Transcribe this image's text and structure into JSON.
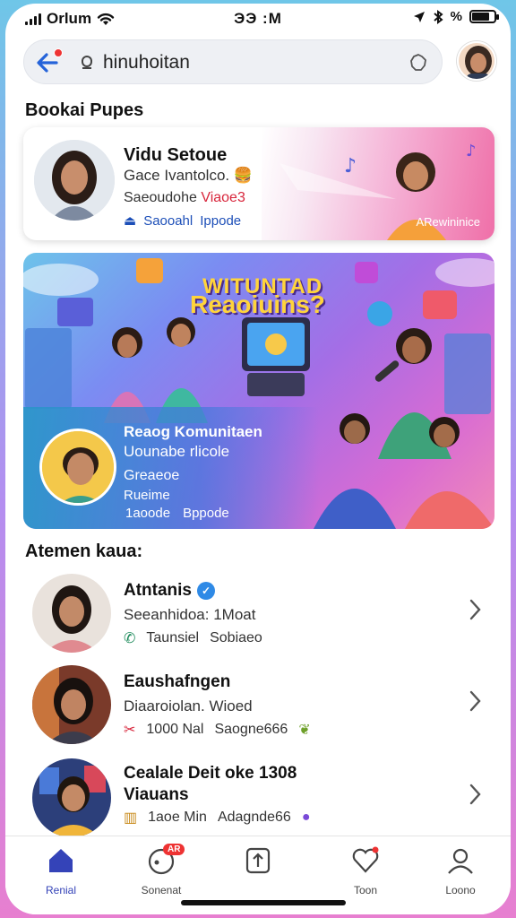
{
  "status_bar": {
    "carrier": "Orlum",
    "time": "ЭЭ :M",
    "extra": "%"
  },
  "search": {
    "query": "hinuhoitan"
  },
  "sections": {
    "top_title": "Bookai Pupes",
    "list_title": "Atemen kaua:"
  },
  "profile_card": {
    "name": "Vidu Setoue",
    "line1": "Gace Ivantolco.",
    "line2_a": "Saeoudohe",
    "line2_b": "Viaoe3",
    "line3_a": "Saooahl",
    "line3_b": "Ippode",
    "badge": "ARewininice"
  },
  "hero": {
    "title1": "WITUNTAD",
    "title2": "Reaoiuins?",
    "line1": "Reaog Komunitaen",
    "line2": "Uounabe rlicole",
    "line3": "Greaeoe",
    "line4": "Rueime",
    "meta_a": "1aoode",
    "meta_b": "Bppode"
  },
  "list": [
    {
      "name": "Atntanis",
      "sub": "Seeanhidoa: 1Moat",
      "meta_a": "Taunsiel",
      "meta_b": "Sobiaeo",
      "verified": true
    },
    {
      "name": "Eaushafngen",
      "sub": "Diaaroiolan. Wioed",
      "meta_a": "1000 Nal",
      "meta_b": "Saogne666"
    },
    {
      "name": "Cealale Deit oke 1308",
      "name2": "Viauans",
      "meta_a": "1aoe Min",
      "meta_b": "Adagnde66"
    }
  ],
  "nav": [
    {
      "label": "Renial",
      "icon": "home-icon",
      "active": true
    },
    {
      "label": "Sonenat",
      "icon": "chat-icon",
      "badge": "AR"
    },
    {
      "label": "",
      "icon": "upload-icon"
    },
    {
      "label": "Toon",
      "icon": "heart-icon"
    },
    {
      "label": "Loono",
      "icon": "profile-icon"
    }
  ],
  "colors": {
    "accent": "#3443b8",
    "link": "#1d4fb8",
    "alert": "#e33333",
    "hero_title": "#ffd43b"
  }
}
